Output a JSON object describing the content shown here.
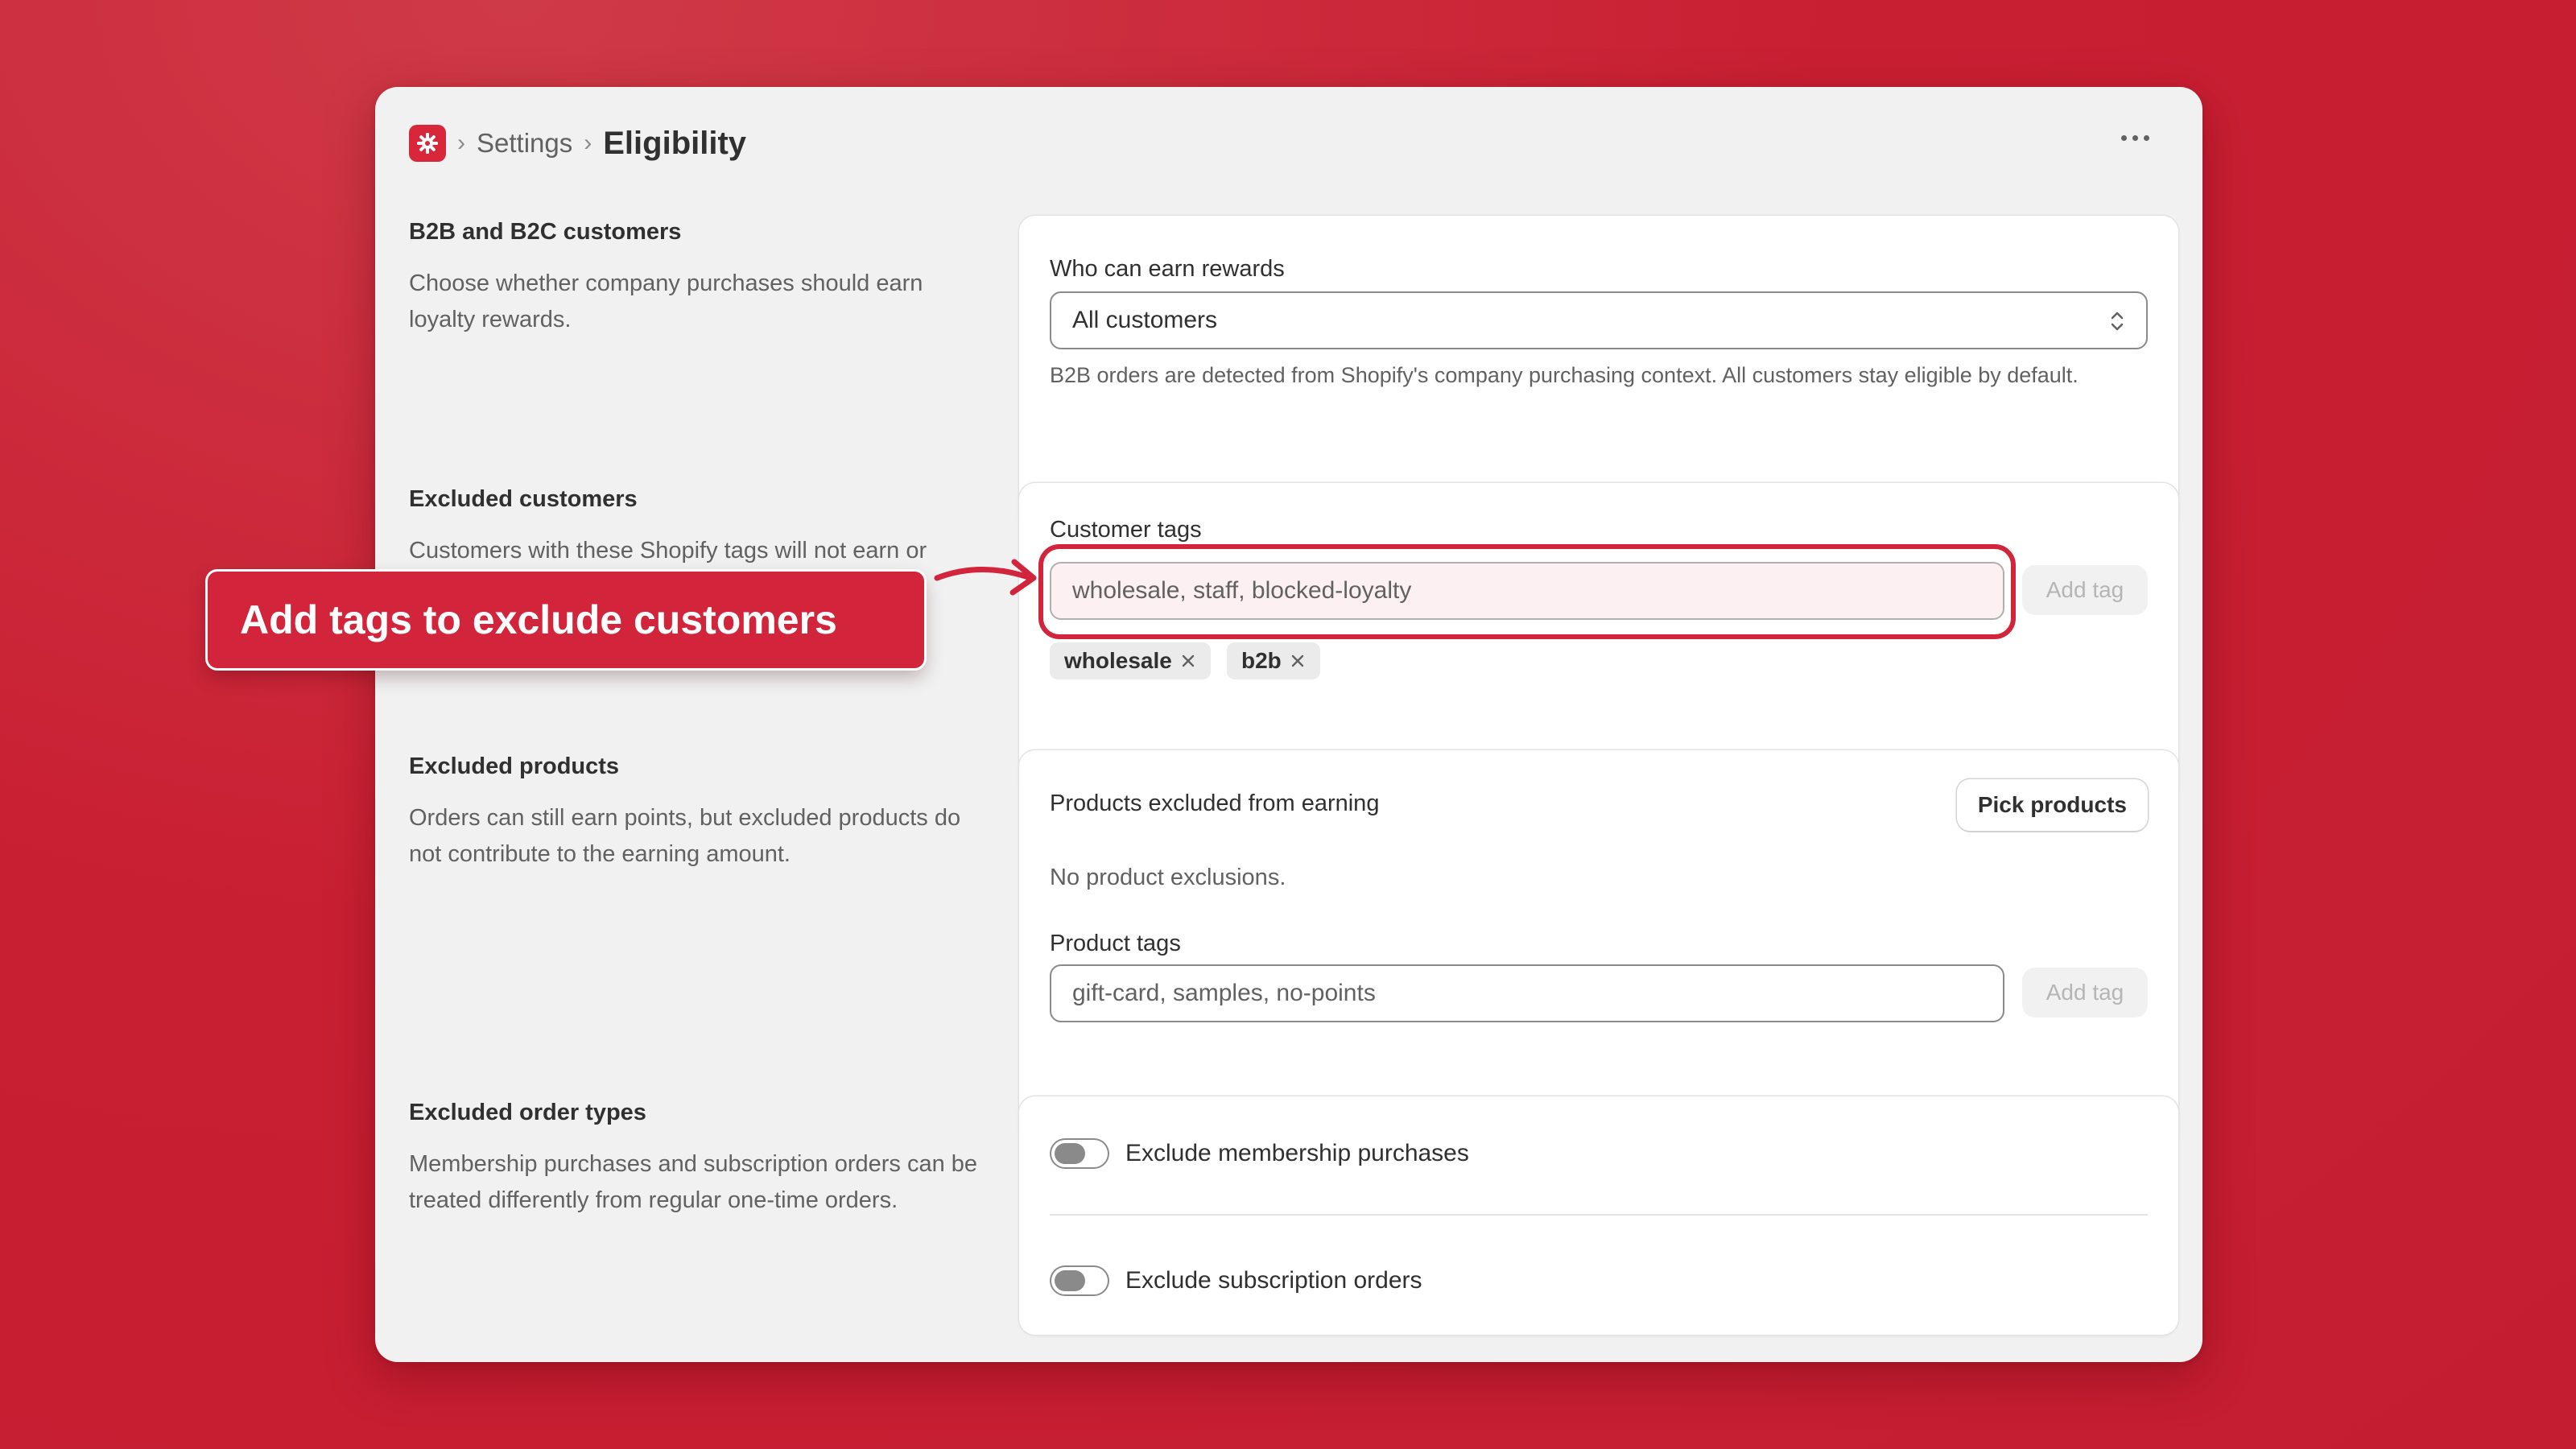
{
  "header": {
    "breadcrumb_parent": "Settings",
    "title": "Eligibility"
  },
  "sections": {
    "b2b": {
      "title": "B2B and B2C customers",
      "description": "Choose whether company purchases should earn loyalty rewards.",
      "field_label": "Who can earn rewards",
      "select_value": "All customers",
      "help_text": "B2B orders are detected from Shopify's company purchasing context. All customers stay eligible by default."
    },
    "excluded_customers": {
      "title": "Excluded customers",
      "description": "Customers with these Shopify tags will not earn or",
      "field_label": "Customer tags",
      "input_placeholder": "wholesale, staff, blocked-loyalty",
      "add_button": "Add tag",
      "tags": [
        "wholesale",
        "b2b"
      ]
    },
    "excluded_products": {
      "title": "Excluded products",
      "description": "Orders can still earn points, but excluded products do not contribute to the earning amount.",
      "card_title": "Products excluded from earning",
      "pick_button": "Pick products",
      "empty_text": "No product exclusions.",
      "field_label": "Product tags",
      "input_placeholder": "gift-card, samples, no-points",
      "add_button": "Add tag"
    },
    "excluded_order_types": {
      "title": "Excluded order types",
      "description": "Membership purchases and subscription orders can be treated differently from regular one-time orders.",
      "toggles": [
        {
          "label": "Exclude membership purchases",
          "on": false
        },
        {
          "label": "Exclude subscription orders",
          "on": false
        }
      ]
    }
  },
  "callout": {
    "text": "Add tags to exclude customers"
  },
  "colors": {
    "accent": "#d2243a",
    "background": "#c91f33",
    "window": "#f1f1f1"
  }
}
